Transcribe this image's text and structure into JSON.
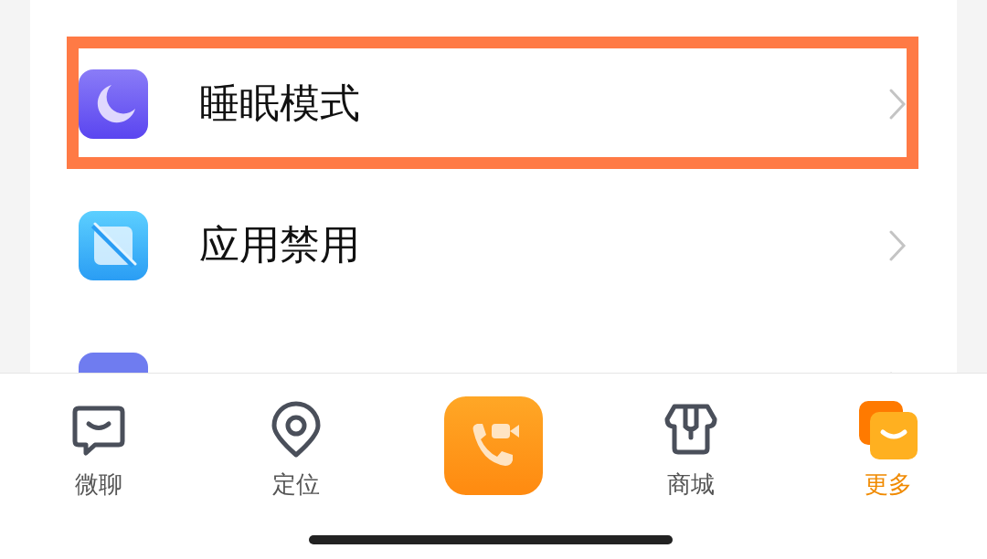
{
  "settings_list": [
    {
      "label": "睡眠模式",
      "highlighted": true
    },
    {
      "label": "应用禁用",
      "highlighted": false
    },
    {
      "highlighted": false
    }
  ],
  "tab_bar": [
    {
      "kind": "tab",
      "label": "微聊",
      "selected": false
    },
    {
      "kind": "tab",
      "label": "定位",
      "selected": false
    },
    {
      "kind": "call"
    },
    {
      "kind": "tab",
      "label": "商城",
      "selected": false
    },
    {
      "kind": "tab",
      "label": "更多",
      "selected": true
    }
  ]
}
